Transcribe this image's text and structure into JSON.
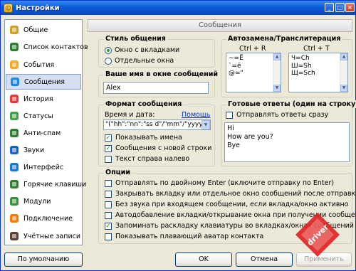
{
  "window": {
    "title": "Настройки",
    "min": "_",
    "max": "□",
    "close": "×"
  },
  "sidebar": {
    "items": [
      {
        "label": "Общие",
        "icon": "general-icon",
        "color": "#C9A227"
      },
      {
        "label": "Список контактов",
        "icon": "contact-list-icon",
        "color": "#2E7D32"
      },
      {
        "label": "События",
        "icon": "events-icon",
        "color": "#F9A825"
      },
      {
        "label": "Сообщения",
        "icon": "messages-icon",
        "color": "#1E88E5"
      },
      {
        "label": "История",
        "icon": "history-icon",
        "color": "#E53935"
      },
      {
        "label": "Статусы",
        "icon": "statuses-icon",
        "color": "#43A047"
      },
      {
        "label": "Анти-спам",
        "icon": "antispam-icon",
        "color": "#2E7D32"
      },
      {
        "label": "Звуки",
        "icon": "sounds-icon",
        "color": "#1565C0"
      },
      {
        "label": "Интерфейс",
        "icon": "interface-icon",
        "color": "#1976D2"
      },
      {
        "label": "Горячие клавиши",
        "icon": "hotkeys-icon",
        "color": "#2E7D32"
      },
      {
        "label": "Модули",
        "icon": "modules-icon",
        "color": "#388E3C"
      },
      {
        "label": "Подключение",
        "icon": "connection-icon",
        "color": "#F57C00"
      },
      {
        "label": "Учётные записи",
        "icon": "accounts-icon",
        "color": "#5D4037"
      }
    ],
    "selected": "Сообщения"
  },
  "panel": {
    "title": "Сообщения"
  },
  "style": {
    "title": "Стиль общения",
    "opt1": "Окно с вкладками",
    "opt2": "Отдельные окна"
  },
  "name": {
    "title": "Ваше имя в окне сообщений",
    "value": "Alex"
  },
  "format": {
    "title": "Формат сообщения",
    "time_label": "Время и дата:",
    "help": "Помощь",
    "time_value": "\"(\"hh\":\"nn\":\"ss d\"/\"mm\"/\"yyyy\")\"",
    "show_names": "Показывать имена",
    "new_line": "Сообщения с новой строки",
    "rtl": "Текст справа налево"
  },
  "autoreplace": {
    "title": "Автозамена/Транслитерация",
    "ctrl_r": "Ctrl + R",
    "ctrl_t": "Ctrl + T",
    "left": [
      "~=Ё",
      "`=ё",
      "@=\""
    ],
    "right": [
      "Ч=Ch",
      "Ш=Sh",
      "Щ=Sch"
    ]
  },
  "replies": {
    "title": "Готовые ответы (один на строку)",
    "send_now": "Отправлять ответы сразу",
    "lines": [
      "Hi",
      "How are you?",
      "Bye"
    ]
  },
  "options": {
    "title": "Опции",
    "items": [
      {
        "label": "Отправлять по двойному Enter (включите отправку по Enter)",
        "checked": false
      },
      {
        "label": "Закрывать вкладку или отдельное окно сообщений после отправки",
        "checked": false
      },
      {
        "label": "Без звука при входящем сообщении, если вкладка/окно активно",
        "checked": false
      },
      {
        "label": "Автодобавление вкладки/открывание окна при получении сообщения",
        "checked": false
      },
      {
        "label": "Запоминать раскладку клавиатуры во вкладках/окнах сообщений",
        "checked": true
      },
      {
        "label": "Показывать плавающий аватар контакта",
        "checked": false
      }
    ]
  },
  "buttons": {
    "default": "По умолчанию",
    "ok": "OK",
    "cancel": "Отмена",
    "apply": "Применить"
  },
  "watermark": "driver"
}
